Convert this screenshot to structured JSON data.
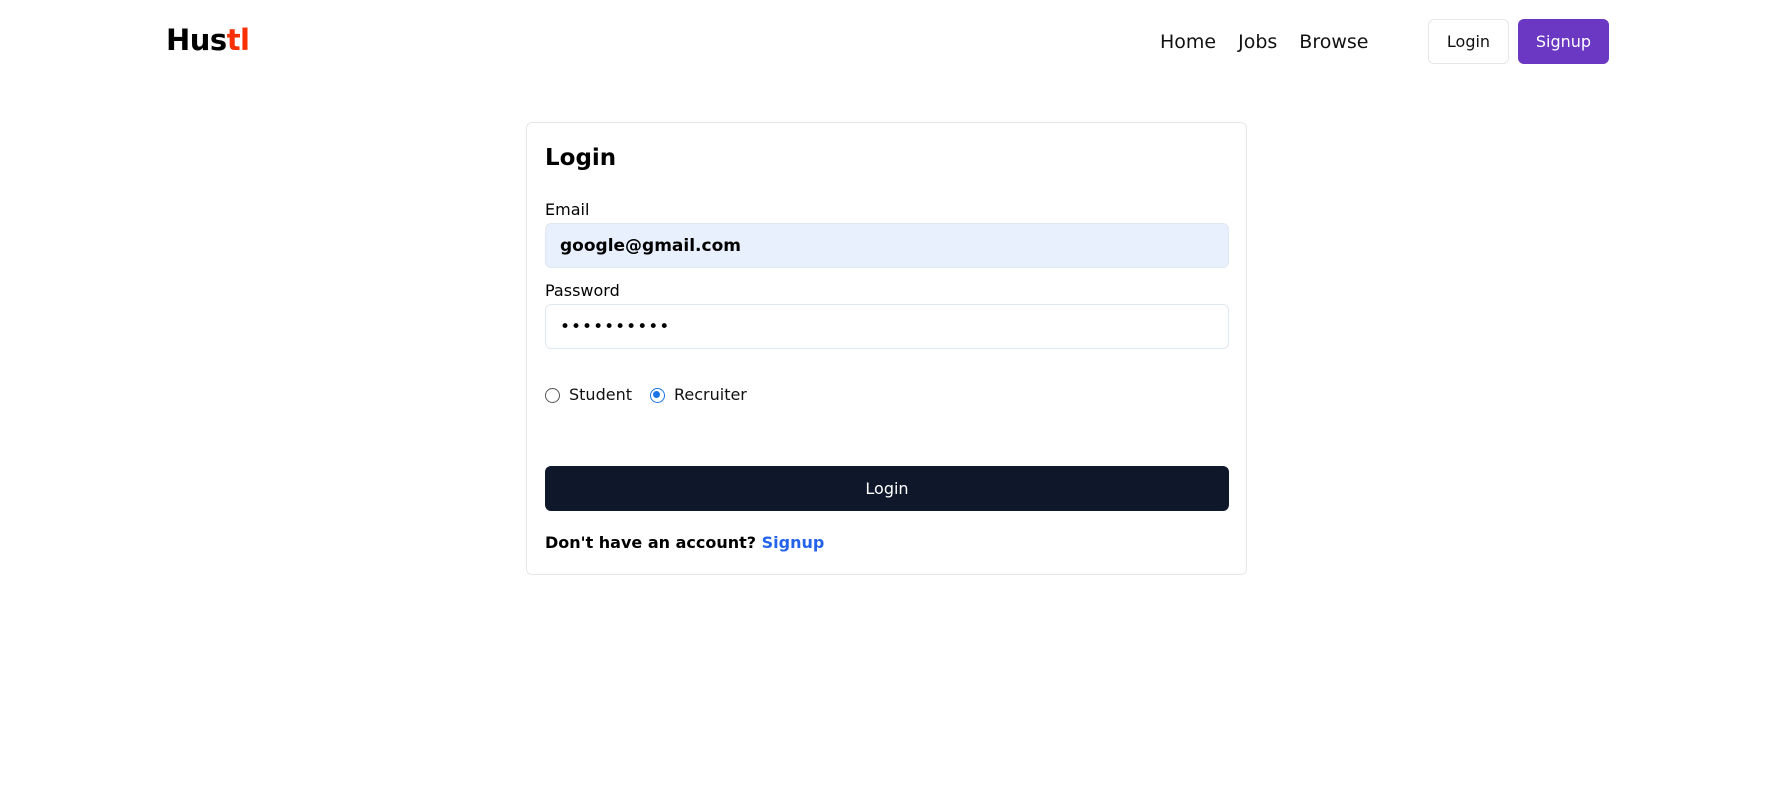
{
  "navbar": {
    "logo_main": "Hus",
    "logo_accent": "tl",
    "links": [
      "Home",
      "Jobs",
      "Browse"
    ],
    "login_label": "Login",
    "signup_label": "Signup"
  },
  "login_form": {
    "title": "Login",
    "email_label": "Email",
    "email_value": "google@gmail.com",
    "password_label": "Password",
    "password_value": "••••••••••",
    "roles": [
      {
        "label": "Student",
        "selected": false
      },
      {
        "label": "Recruiter",
        "selected": true
      }
    ],
    "submit_label": "Login",
    "footer_prompt": "Don't have an account?",
    "footer_link": "Signup"
  },
  "colors": {
    "brand_accent": "#f83002",
    "signup_button": "#6a38c2",
    "submit_button": "#0f172a",
    "link": "#2563eb",
    "autofill_bg": "#e8f0fe"
  }
}
